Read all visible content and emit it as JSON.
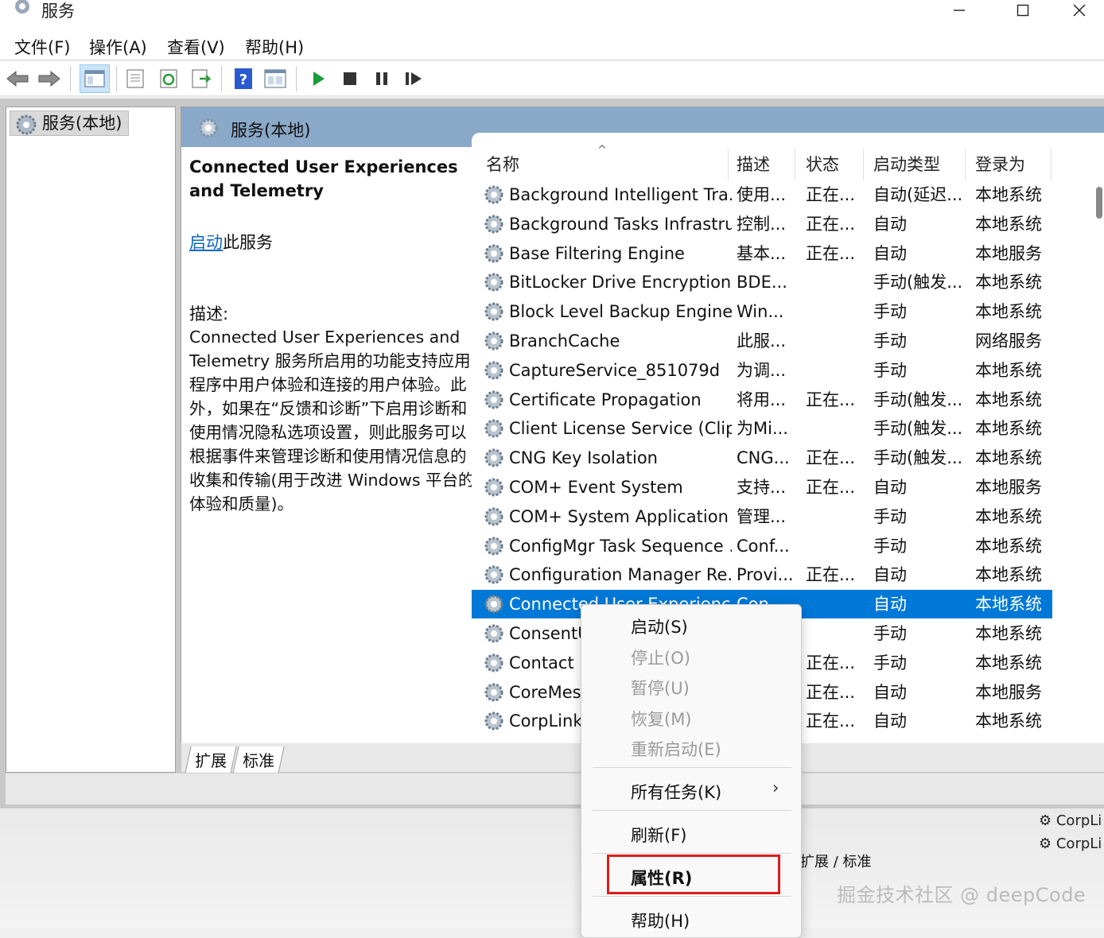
{
  "window": {
    "title": "服务",
    "icon": "services-gear-icon"
  },
  "menu": [
    "文件(F)",
    "操作(A)",
    "查看(V)",
    "帮助(H)"
  ],
  "toolbar": {
    "icons": [
      "back-arrow-icon",
      "forward-arrow-icon",
      "show-hide-tree-icon",
      "properties-sheet-icon",
      "refresh-icon",
      "export-list-icon",
      "help-icon",
      "console-view-icon",
      "start-service-icon",
      "stop-service-icon",
      "pause-service-icon",
      "resume-service-icon"
    ],
    "colors": {
      "start": "#1a9c3a",
      "stop": "#333333"
    }
  },
  "tree": {
    "item": "服务(本地)"
  },
  "pane": {
    "header": "服务(本地)"
  },
  "details": {
    "service_title": "Connected User Experiences and Telemetry",
    "start_link": "启动",
    "start_suffix": "此服务",
    "desc_label": "描述:",
    "description": "Connected User Experiences and Telemetry 服务所启用的功能支持应用程序中用户体验和连接的用户体验。此外，如果在“反馈和诊断”下启用诊断和使用情况隐私选项设置，则此服务可以根据事件来管理诊断和使用情况信息的收集和传输(用于改进 Windows 平台的体验和质量)。"
  },
  "columns": {
    "name": "名称",
    "desc": "描述",
    "status": "状态",
    "startup": "启动类型",
    "logon": "登录为"
  },
  "rows": [
    {
      "name": "Background Intelligent Tra...",
      "desc": "使用...",
      "status": "正在...",
      "startup": "自动(延迟...",
      "logon": "本地系统"
    },
    {
      "name": "Background Tasks Infrastru...",
      "desc": "控制...",
      "status": "正在...",
      "startup": "自动",
      "logon": "本地系统"
    },
    {
      "name": "Base Filtering Engine",
      "desc": "基本...",
      "status": "正在...",
      "startup": "自动",
      "logon": "本地服务"
    },
    {
      "name": "BitLocker Drive Encryption ...",
      "desc": "BDE...",
      "status": "",
      "startup": "手动(触发...",
      "logon": "本地系统"
    },
    {
      "name": "Block Level Backup Engine ...",
      "desc": "Win...",
      "status": "",
      "startup": "手动",
      "logon": "本地系统"
    },
    {
      "name": "BranchCache",
      "desc": "此服...",
      "status": "",
      "startup": "手动",
      "logon": "网络服务"
    },
    {
      "name": "CaptureService_851079d",
      "desc": "为调...",
      "status": "",
      "startup": "手动",
      "logon": "本地系统"
    },
    {
      "name": "Certificate Propagation",
      "desc": "将用...",
      "status": "正在...",
      "startup": "手动(触发...",
      "logon": "本地系统"
    },
    {
      "name": "Client License Service (Clip...",
      "desc": "为Mi...",
      "status": "",
      "startup": "手动(触发...",
      "logon": "本地系统"
    },
    {
      "name": "CNG Key Isolation",
      "desc": "CNG...",
      "status": "正在...",
      "startup": "手动(触发...",
      "logon": "本地系统"
    },
    {
      "name": "COM+ Event System",
      "desc": "支持...",
      "status": "正在...",
      "startup": "自动",
      "logon": "本地服务"
    },
    {
      "name": "COM+ System Application",
      "desc": "管理...",
      "status": "",
      "startup": "手动",
      "logon": "本地系统"
    },
    {
      "name": "ConfigMgr Task Sequence ...",
      "desc": "Conf...",
      "status": "",
      "startup": "手动",
      "logon": "本地系统"
    },
    {
      "name": "Configuration Manager Re...",
      "desc": "Provi...",
      "status": "正在...",
      "startup": "自动",
      "logon": "本地系统"
    },
    {
      "name": "Connected User Experienc...",
      "desc": "Con...",
      "status": "",
      "startup": "自动",
      "logon": "本地系统",
      "selected": true
    },
    {
      "name": "ConsentUX",
      "desc": "",
      "status": "",
      "startup": "手动",
      "logon": "本地系统"
    },
    {
      "name": "Contact Data",
      "desc": "",
      "status": "正在...",
      "startup": "手动",
      "logon": "本地系统"
    },
    {
      "name": "CoreMessaging",
      "desc": "",
      "status": "正在...",
      "startup": "自动",
      "logon": "本地服务"
    },
    {
      "name": "CorpLink",
      "desc": "",
      "status": "正在...",
      "startup": "自动",
      "logon": "本地系统"
    }
  ],
  "tabs": [
    "扩展",
    "标准"
  ],
  "context_menu": {
    "items": [
      {
        "label": "启动(S)",
        "enabled": true
      },
      {
        "label": "停止(O)",
        "enabled": false
      },
      {
        "label": "暂停(U)",
        "enabled": false
      },
      {
        "label": "恢复(M)",
        "enabled": false
      },
      {
        "label": "重新启动(E)",
        "enabled": false
      },
      {
        "label": "所有任务(K)",
        "enabled": true,
        "submenu": "›"
      },
      {
        "label": "刷新(F)",
        "enabled": true
      },
      {
        "label": "属性(R)",
        "enabled": true,
        "highlighted": true
      },
      {
        "label": "帮助(H)",
        "enabled": true
      }
    ],
    "highlight_color": "#e01b1b"
  },
  "background_window": {
    "items": [
      "CorpLi",
      "CorpLi"
    ],
    "tabs": [
      "扩展",
      "标准"
    ]
  },
  "watermark": "掘金技术社区 @ deepCode"
}
